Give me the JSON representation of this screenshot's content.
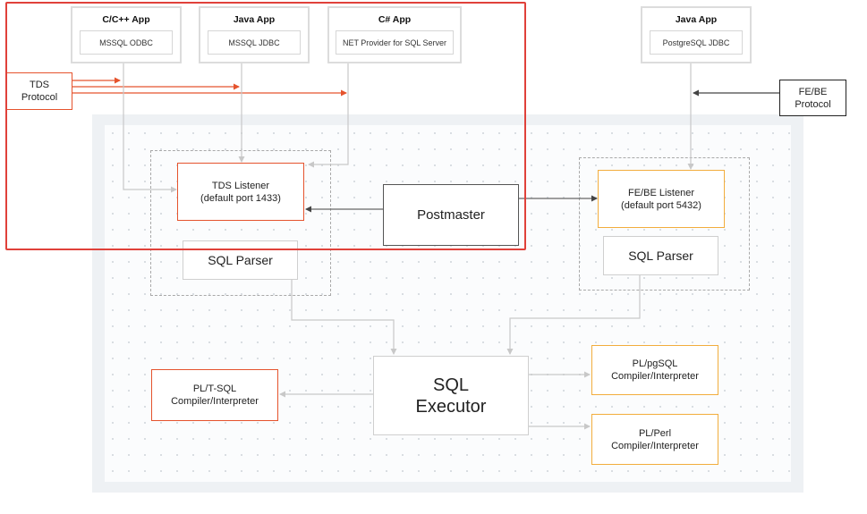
{
  "apps": [
    {
      "title": "C/C++ App",
      "driver": "MSSQL ODBC"
    },
    {
      "title": "Java App",
      "driver": "MSSQL JDBC"
    },
    {
      "title": "C# App",
      "driver": "NET Provider for SQL Server"
    },
    {
      "title": "Java App",
      "driver": "PostgreSQL JDBC"
    }
  ],
  "protocols": {
    "tds": "TDS\nProtocol",
    "febe": "FE/BE\nProtocol"
  },
  "components": {
    "tds_listener": "TDS Listener\n(default port 1433)",
    "febe_listener": "FE/BE Listener\n(default port 5432)",
    "postmaster": "Postmaster",
    "sql_parser_left": "SQL Parser",
    "sql_parser_right": "SQL Parser",
    "sql_executor": "SQL\nExecutor",
    "pl_tsql": "PL/T-SQL\nCompiler/Interpreter",
    "pl_pgsql": "PL/pgSQL\nCompiler/Interpreter",
    "pl_perl": "PL/Perl\nCompiler/Interpreter"
  },
  "colors": {
    "tds_accent": "#e5532d",
    "pg_accent": "#f2ad3d",
    "connector": "#c8c8c8",
    "highlight": "#e0413a"
  }
}
